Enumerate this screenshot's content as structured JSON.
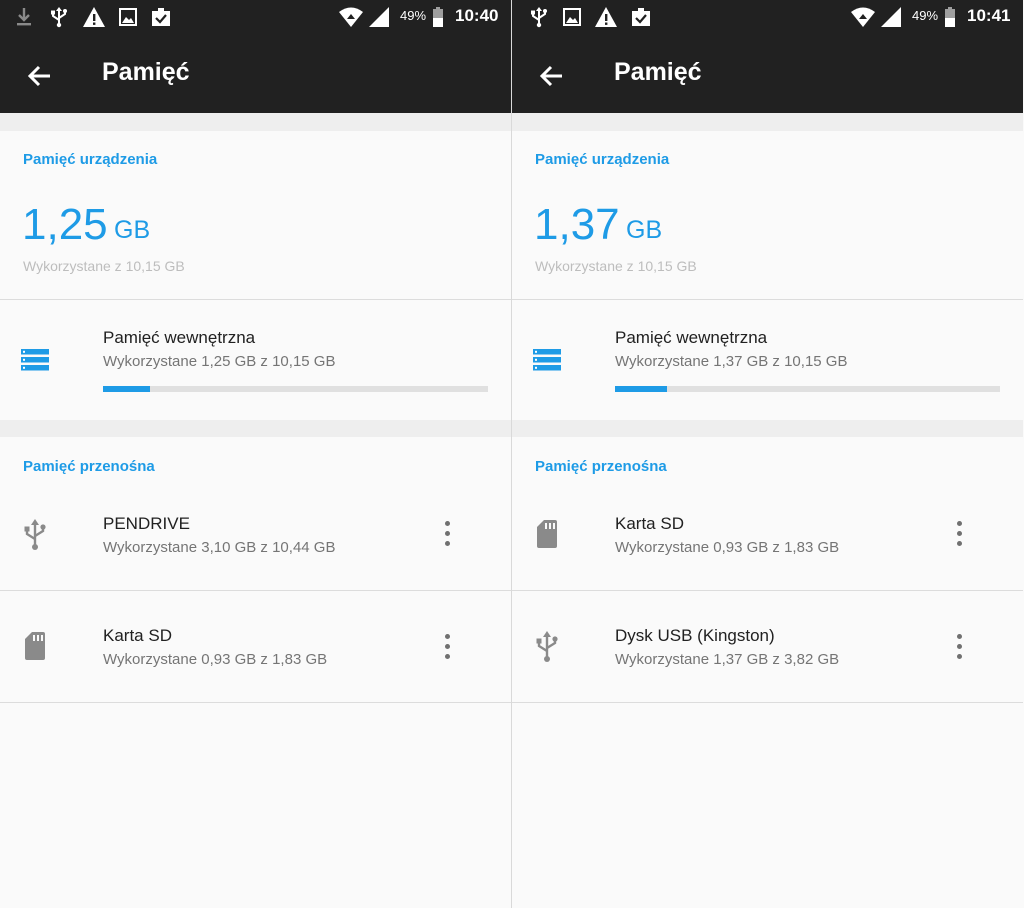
{
  "colors": {
    "accent": "#1e9be6",
    "appbar": "#212121",
    "background": "#fafafa"
  },
  "panels": [
    {
      "status": {
        "battery": "49%",
        "time": "10:40",
        "icons": [
          "download-icon",
          "usb-icon",
          "warning-icon",
          "image-icon",
          "clipboard-check-icon",
          "wifi-icon",
          "signal-icon",
          "battery-icon"
        ]
      },
      "toolbar": {
        "title": "Pamięć"
      },
      "device": {
        "label": "Pamięć urządzenia",
        "used_value": "1,25",
        "used_unit": "GB",
        "used_of": "Wykorzystane z 10,15 GB"
      },
      "internal": {
        "title": "Pamięć wewnętrzna",
        "subtitle": "Wykorzystane 1,25 GB z 10,15 GB",
        "usage_fraction": 0.123
      },
      "portable": {
        "label": "Pamięć przenośna",
        "items": [
          {
            "title": "PENDRIVE",
            "subtitle": "Wykorzystane 3,10 GB z 10,44 GB",
            "icon": "usb-icon"
          },
          {
            "title": "Karta SD",
            "subtitle": "Wykorzystane 0,93 GB z 1,83 GB",
            "icon": "sd-card-icon"
          }
        ]
      }
    },
    {
      "status": {
        "battery": "49%",
        "time": "10:41",
        "icons": [
          "usb-icon",
          "image-icon",
          "warning-icon",
          "clipboard-check-icon",
          "wifi-icon",
          "signal-icon",
          "battery-icon"
        ]
      },
      "toolbar": {
        "title": "Pamięć"
      },
      "device": {
        "label": "Pamięć urządzenia",
        "used_value": "1,37",
        "used_unit": "GB",
        "used_of": "Wykorzystane z 10,15 GB"
      },
      "internal": {
        "title": "Pamięć wewnętrzna",
        "subtitle": "Wykorzystane 1,37 GB z 10,15 GB",
        "usage_fraction": 0.135
      },
      "portable": {
        "label": "Pamięć przenośna",
        "items": [
          {
            "title": "Karta SD",
            "subtitle": "Wykorzystane 0,93 GB z 1,83 GB",
            "icon": "sd-card-icon"
          },
          {
            "title": "Dysk USB (Kingston)",
            "subtitle": "Wykorzystane 1,37 GB z 3,82 GB",
            "icon": "usb-icon"
          }
        ]
      }
    }
  ]
}
